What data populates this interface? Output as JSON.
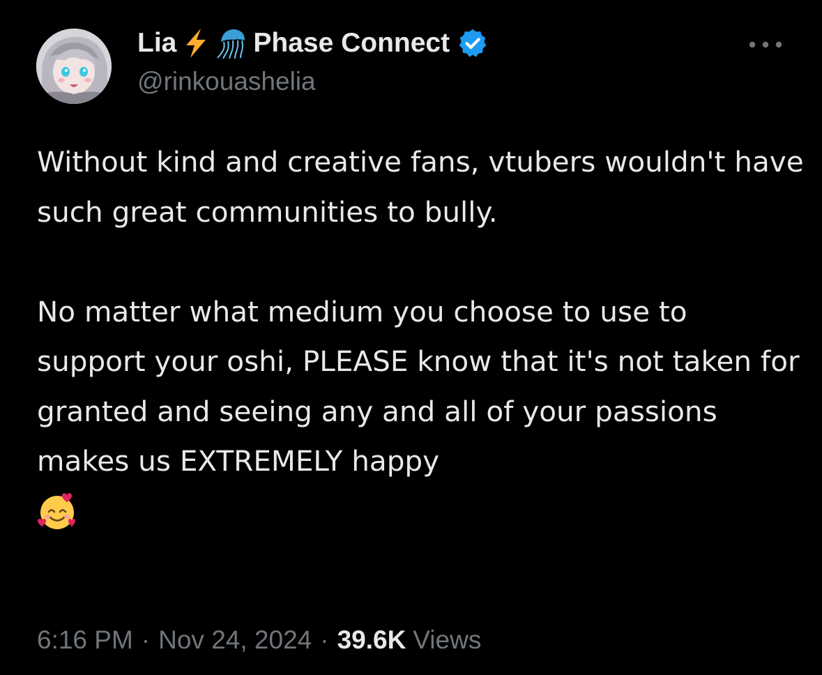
{
  "author": {
    "name": "Lia",
    "name_suffix": "Phase Connect",
    "handle": "@rinkouashelia",
    "verified": true,
    "name_emojis": [
      "lightning-emoji",
      "jellyfish-emoji"
    ]
  },
  "tweet": {
    "paragraphs": [
      "Without kind and creative fans, vtubers wouldn't have such great communities to bully.",
      "No matter what medium you choose to use to support your oshi, PLEASE know that it's not taken for granted and seeing any and all of your passions makes us EXTREMELY happy"
    ],
    "trailing_emoji": "smiling-face-with-hearts-emoji"
  },
  "meta": {
    "time": "6:16 PM",
    "separator": "·",
    "date": "Nov 24, 2024",
    "views_count": "39.6K",
    "views_label": "Views"
  },
  "icons": {
    "more": "more-icon",
    "verified": "verified-badge-icon"
  },
  "colors": {
    "background": "#000000",
    "text_primary": "#e7e9ea",
    "text_secondary": "#71767b",
    "verified_blue": "#1d9bf0",
    "lightning": "#ffac33"
  }
}
